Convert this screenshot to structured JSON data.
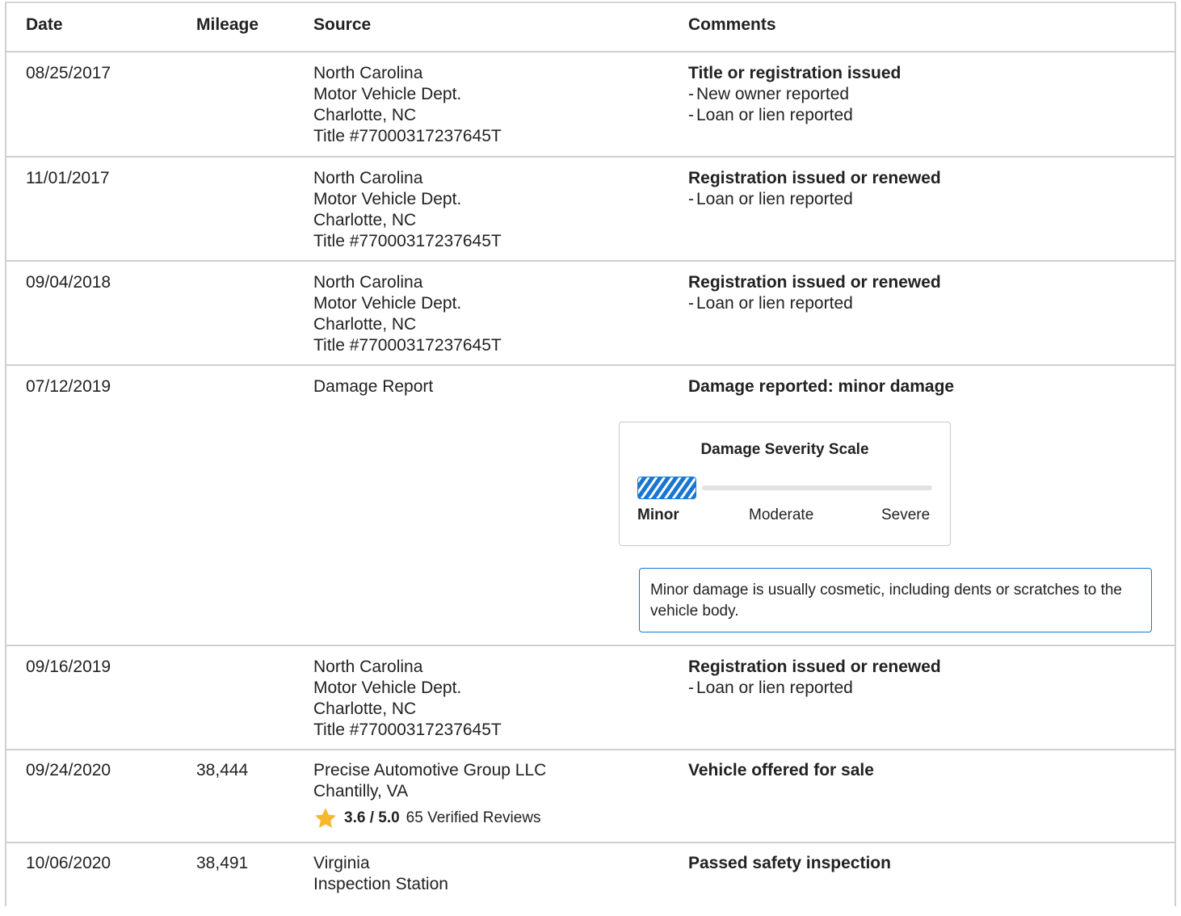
{
  "headers": {
    "date": "Date",
    "mileage": "Mileage",
    "source": "Source",
    "comments": "Comments"
  },
  "rows": [
    {
      "date": "08/25/2017",
      "mileage": "",
      "source": [
        "North Carolina",
        "Motor Vehicle Dept.",
        "Charlotte, NC",
        "Title #77000317237645T"
      ],
      "comment_title": "Title or registration issued",
      "comment_items": [
        "New owner reported",
        "Loan or lien reported"
      ]
    },
    {
      "date": "11/01/2017",
      "mileage": "",
      "source": [
        "North Carolina",
        "Motor Vehicle Dept.",
        "Charlotte, NC",
        "Title #77000317237645T"
      ],
      "comment_title": "Registration issued or renewed",
      "comment_items": [
        "Loan or lien reported"
      ]
    },
    {
      "date": "09/04/2018",
      "mileage": "",
      "source": [
        "North Carolina",
        "Motor Vehicle Dept.",
        "Charlotte, NC",
        "Title #77000317237645T"
      ],
      "comment_title": "Registration issued or renewed",
      "comment_items": [
        "Loan or lien reported"
      ]
    },
    {
      "date": "07/12/2019",
      "mileage": "",
      "source": [
        "Damage Report"
      ],
      "comment_title": "Damage reported: minor damage",
      "comment_items": [],
      "severity_scale": {
        "title": "Damage Severity Scale",
        "labels": [
          "Minor",
          "Moderate",
          "Severe"
        ],
        "selected": "Minor",
        "level_fraction": 0.2,
        "accent_color": "#1976d2"
      },
      "info_note": "Minor damage is usually cosmetic, including dents or scratches to the vehicle body."
    },
    {
      "date": "09/16/2019",
      "mileage": "",
      "source": [
        "North Carolina",
        "Motor Vehicle Dept.",
        "Charlotte, NC",
        "Title #77000317237645T"
      ],
      "comment_title": "Registration issued or renewed",
      "comment_items": [
        "Loan or lien reported"
      ]
    },
    {
      "date": "09/24/2020",
      "mileage": "38,444",
      "source": [
        "Precise Automotive Group LLC",
        "Chantilly, VA"
      ],
      "rating": {
        "icon": "star-icon",
        "score": "3.6 / 5.0",
        "reviews": "65 Verified Reviews",
        "star_color": "#f5b82e"
      },
      "comment_title": "Vehicle offered for sale",
      "comment_items": []
    },
    {
      "date": "10/06/2020",
      "mileage": "38,491",
      "source": [
        "Virginia",
        "Inspection Station"
      ],
      "comment_title": "Passed safety inspection",
      "comment_items": []
    }
  ]
}
